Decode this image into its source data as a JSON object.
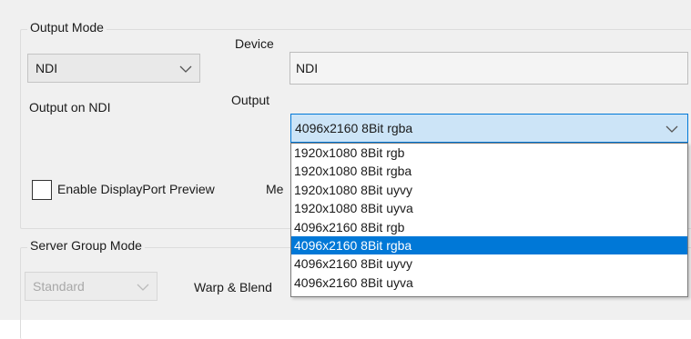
{
  "output_mode": {
    "title": "Output Mode",
    "mode_value": "NDI",
    "device_label": "Device",
    "device_value": "NDI",
    "output_on_label": "Output on NDI",
    "output_label": "Output",
    "output_value": "4096x2160 8Bit rgba",
    "output_options": [
      "1920x1080 8Bit rgb",
      "1920x1080 8Bit rgba",
      "1920x1080 8Bit uyvy",
      "1920x1080 8Bit uyva",
      "4096x2160 8Bit rgb",
      "4096x2160 8Bit rgba",
      "4096x2160 8Bit uyvy",
      "4096x2160 8Bit uyva"
    ],
    "selected_option_index": 5,
    "enable_preview_label": "Enable DisplayPort Preview",
    "enable_preview_checked": false,
    "truncated_label": "Me"
  },
  "server_group": {
    "title": "Server Group Mode",
    "mode_value": "Standard",
    "warp_blend_label": "Warp & Blend"
  },
  "icons": {
    "chevron": "chevron-down-icon"
  },
  "colors": {
    "accent": "#0078d7",
    "highlight": "#cce4f7"
  }
}
